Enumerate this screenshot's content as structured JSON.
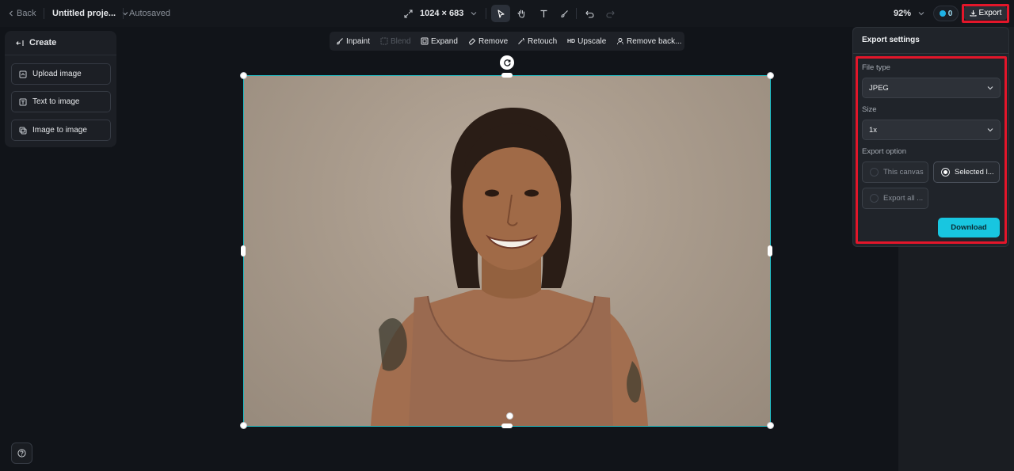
{
  "topbar": {
    "back_label": "Back",
    "project_title": "Untitled proje...",
    "save_status": "Autosaved",
    "canvas_size": "1024 × 683",
    "zoom": "92%",
    "credits": "0",
    "export_label": "Export"
  },
  "create_panel": {
    "title": "Create",
    "buttons": [
      {
        "label": "Upload image",
        "icon": "upload-icon"
      },
      {
        "label": "Text to image",
        "icon": "text-icon"
      },
      {
        "label": "Image to image",
        "icon": "image-icon"
      }
    ]
  },
  "edit_toolbar": {
    "items": [
      {
        "label": "Inpaint",
        "icon": "brush-icon",
        "disabled": false
      },
      {
        "label": "Blend",
        "icon": "blend-icon",
        "disabled": true
      },
      {
        "label": "Expand",
        "icon": "expand-icon",
        "disabled": false
      },
      {
        "label": "Remove",
        "icon": "eraser-icon",
        "disabled": false
      },
      {
        "label": "Retouch",
        "icon": "magic-wand-icon",
        "disabled": false
      },
      {
        "label": "Upscale",
        "icon_text": "HD",
        "disabled": false
      },
      {
        "label": "Remove back...",
        "icon": "remove-bg-icon",
        "disabled": false
      }
    ]
  },
  "export_settings": {
    "title": "Export settings",
    "file_type_label": "File type",
    "file_type_value": "JPEG",
    "size_label": "Size",
    "size_value": "1x",
    "export_option_label": "Export option",
    "options": [
      {
        "label": "This canvas",
        "selected": false
      },
      {
        "label": "Selected l...",
        "selected": true
      },
      {
        "label": "Export all ...",
        "selected": false
      }
    ],
    "download_label": "Download"
  },
  "colors": {
    "accent": "#18c6e0",
    "selection": "#25c5cc",
    "highlight": "#e3162a",
    "background": "#111419"
  }
}
